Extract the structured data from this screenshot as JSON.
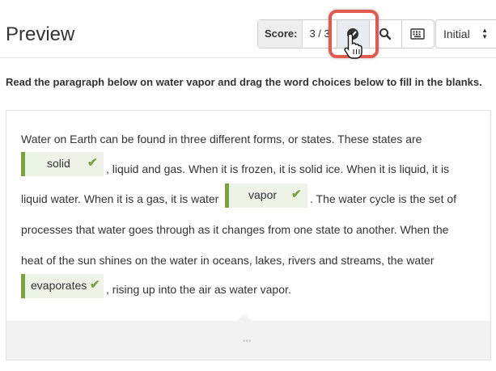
{
  "header": {
    "title": "Preview"
  },
  "toolbar": {
    "score_label": "Score:",
    "score_value": "3 / 3",
    "buttons": [
      {
        "icon": "check-icon",
        "active": true
      },
      {
        "icon": "search-icon",
        "active": false
      },
      {
        "icon": "keyboard-icon",
        "active": false
      }
    ],
    "select_value": "Initial"
  },
  "question": {
    "instruction": "Read the paragraph below on water vapor and drag the word choices below to fill in the blanks.",
    "line1": "Water on Earth can be found in three different forms, or states. These states are",
    "line2_after": ", liquid and gas. When it is frozen, it is solid ice. When it is liquid, it is",
    "line3_before": "liquid water. When it is a gas, it is water",
    "line3_after": ". The water cycle is the set of",
    "line4": "processes that water goes through as it changes from one state to another. When the",
    "line5": "heat of the sun shines on the water in oceans, lakes, rivers and streams, the water",
    "line6_after": ", rising up into the air as water vapor.",
    "blanks": [
      {
        "word": "solid",
        "correct": true
      },
      {
        "word": "vapor",
        "correct": true
      },
      {
        "word": "evaporates",
        "correct": true
      }
    ],
    "check_mark": "✔"
  },
  "colors": {
    "correct_accent": "#7aa33a",
    "chip_background": "#eef3e8",
    "highlight_ring": "#e05a4f"
  }
}
